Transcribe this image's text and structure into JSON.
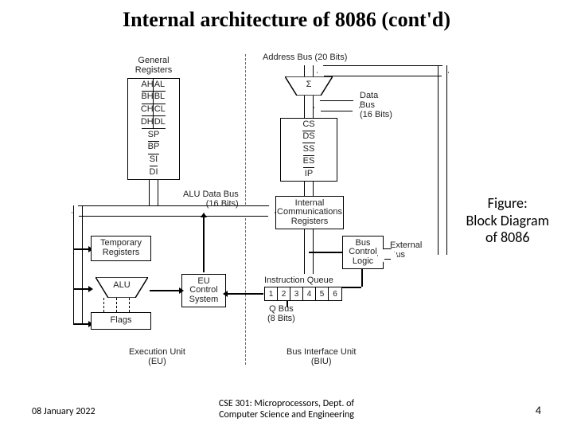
{
  "title": "Internal architecture of 8086 (cont'd)",
  "caption_l1": "Figure:",
  "caption_l2": "Block Diagram",
  "caption_l3": "of 8086",
  "footer": {
    "date": "08 January 2022",
    "course_l1": "CSE 301: Microprocessors, Dept. of",
    "course_l2": "Computer Science and Engineering",
    "page": "4"
  },
  "labels": {
    "general_registers": "General\nRegisters",
    "address_bus": "Address Bus (20 Bits)",
    "sigma": "Σ",
    "data_bus": "Data\nBus\n(16 Bits)",
    "alu_data_bus": "ALU Data Bus\n(16 Bits)",
    "internal_comm": "Internal\nCommunications\nRegisters",
    "temp_regs": "Temporary\nRegisters",
    "alu": "ALU",
    "eu_control": "EU\nControl\nSystem",
    "flags": "Flags",
    "bus_control": "Bus\nControl\nLogic",
    "external_bus": "External\nBus",
    "instruction_queue": "Instruction Queue",
    "q_bus": "Q Bus\n(8 Bits)",
    "execution_unit": "Execution Unit\n(EU)",
    "biu": "Bus Interface Unit\n(BIU)"
  },
  "gen_regs": {
    "rows_hl": [
      [
        "AH",
        "AL"
      ],
      [
        "BH",
        "BL"
      ],
      [
        "CH",
        "CL"
      ],
      [
        "DH",
        "DL"
      ]
    ],
    "rows_full": [
      "SP",
      "BP",
      "SI",
      "DI"
    ]
  },
  "seg_regs": [
    "CS",
    "DS",
    "SS",
    "ES",
    "IP"
  ],
  "queue_cells": [
    "1",
    "2",
    "3",
    "4",
    "5",
    "6"
  ]
}
